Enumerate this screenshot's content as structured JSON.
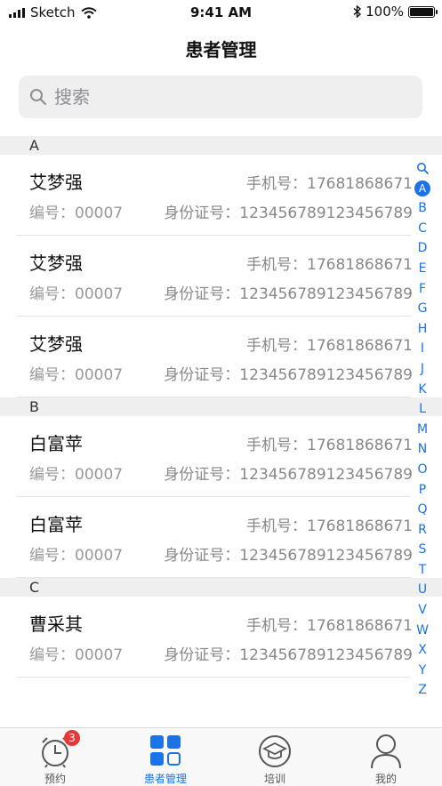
{
  "status": {
    "carrier": "Sketch",
    "time": "9:41 AM",
    "battery": "100%"
  },
  "header": {
    "title": "患者管理"
  },
  "search": {
    "placeholder": "搜索"
  },
  "sections": [
    {
      "letter": "A",
      "rows": [
        {
          "name": "艾梦强",
          "phone": "手机号：17681868671",
          "number": "编号：00007",
          "id": "身份证号：123456789123456789"
        },
        {
          "name": "艾梦强",
          "phone": "手机号：17681868671",
          "number": "编号：00007",
          "id": "身份证号：123456789123456789"
        },
        {
          "name": "艾梦强",
          "phone": "手机号：17681868671",
          "number": "编号：00007",
          "id": "身份证号：123456789123456789"
        }
      ]
    },
    {
      "letter": "B",
      "rows": [
        {
          "name": "白富苹",
          "phone": "手机号：17681868671",
          "number": "编号：00007",
          "id": "身份证号：123456789123456789"
        },
        {
          "name": "白富苹",
          "phone": "手机号：17681868671",
          "number": "编号：00007",
          "id": "身份证号：123456789123456789"
        }
      ]
    },
    {
      "letter": "C",
      "rows": [
        {
          "name": "曹采其",
          "phone": "手机号：17681868671",
          "number": "编号：00007",
          "id": "身份证号：123456789123456789"
        }
      ]
    }
  ],
  "index": {
    "search_glyph": "🔍",
    "active": "A",
    "letters": [
      "A",
      "B",
      "C",
      "D",
      "E",
      "F",
      "G",
      "H",
      "I",
      "J",
      "K",
      "L",
      "M",
      "N",
      "O",
      "P",
      "Q",
      "R",
      "S",
      "T",
      "U",
      "V",
      "W",
      "X",
      "Y",
      "Z"
    ]
  },
  "tabs": [
    {
      "label": "预约",
      "icon": "alarm-clock-icon",
      "badge": "3"
    },
    {
      "label": "患者管理",
      "icon": "grid-icon",
      "active": true
    },
    {
      "label": "培训",
      "icon": "graduation-cap-icon"
    },
    {
      "label": "我的",
      "icon": "user-icon"
    }
  ],
  "colors": {
    "accent": "#1a73e8",
    "badge": "#e53935",
    "section_bg": "#efeff0"
  }
}
